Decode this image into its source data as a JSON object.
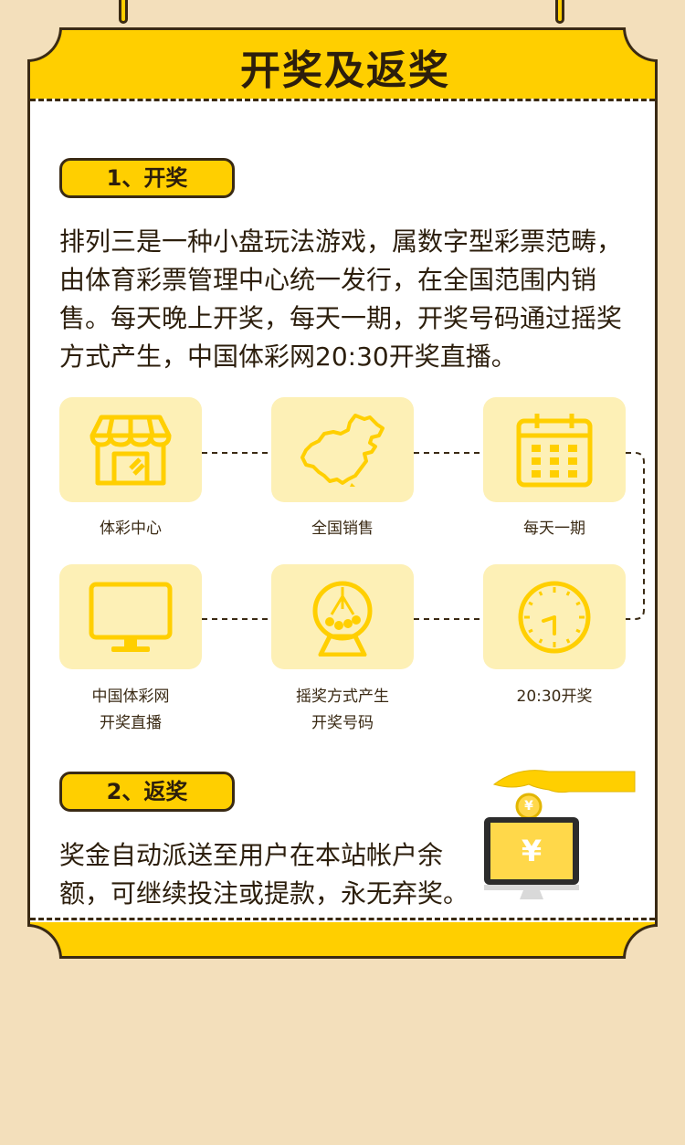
{
  "header": {
    "title": "开奖及返奖"
  },
  "section1": {
    "label": "1、开奖",
    "lines": [
      "排列三是一种小盘玩法游戏，属数字型彩票范畴，",
      "由体育彩票管理中心统一发行，在全国范围内销",
      "售。每天晚上开奖，每天一期，开奖号码通过摇奖",
      "方式产生，中国体彩网20:30开奖直播。"
    ]
  },
  "steps": [
    {
      "icon": "shop-icon",
      "caption": [
        "体彩中心"
      ]
    },
    {
      "icon": "china-map-icon",
      "caption": [
        "全国销售"
      ]
    },
    {
      "icon": "calendar-icon",
      "caption": [
        "每天一期"
      ]
    },
    {
      "icon": "tv-monitor-icon",
      "caption": [
        "中国体彩网",
        "开奖直播"
      ]
    },
    {
      "icon": "lottery-machine-icon",
      "caption": [
        "摇奖方式产生",
        "开奖号码"
      ]
    },
    {
      "icon": "clock-icon",
      "caption": [
        "20:30开奖"
      ]
    }
  ],
  "section2": {
    "label": "2、返奖",
    "lines": [
      "奖金自动派送至用户在本站帐户余",
      "额，可继续投注或提款，永无弃奖。"
    ],
    "coin_symbol": "¥",
    "screen_symbol": "¥"
  },
  "colors": {
    "accent": "#ffcf00",
    "outline": "#3a2a14",
    "tile": "#fdf0b6",
    "icon": "#ffcf00",
    "background": "#f3dfbb"
  }
}
